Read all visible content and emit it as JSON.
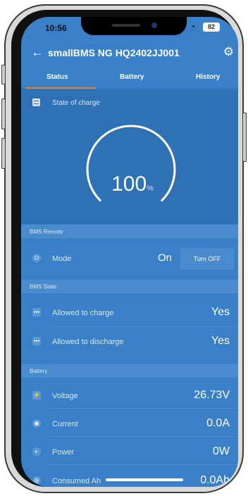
{
  "status_bar": {
    "time": "10:56",
    "battery": "82"
  },
  "header": {
    "title": "smallBMS NG HQ2402JJ001"
  },
  "tabs": [
    {
      "label": "Status"
    },
    {
      "label": "Battery"
    },
    {
      "label": "History"
    }
  ],
  "soc": {
    "label": "State of charge",
    "value": "100",
    "unit": "%",
    "fraction": 1.0
  },
  "bms_remote": {
    "section": "BMS Remote",
    "mode_label": "Mode",
    "mode_value": "On",
    "button_label": "Turn OFF"
  },
  "bms_state": {
    "section": "BMS State",
    "allowed_charge_label": "Allowed to charge",
    "allowed_charge_value": "Yes",
    "allowed_discharge_label": "Allowed to discharge",
    "allowed_discharge_value": "Yes"
  },
  "battery": {
    "section": "Battery",
    "voltage_label": "Voltage",
    "voltage_value": "26.73V",
    "current_label": "Current",
    "current_value": "0.0A",
    "power_label": "Power",
    "power_value": "0W",
    "consumed_label": "Consumed Ah",
    "consumed_value": "0.0Ah"
  },
  "colors": {
    "accent": "#e87e2c",
    "primary": "#3a80c8",
    "panel": "#2f71b5"
  }
}
